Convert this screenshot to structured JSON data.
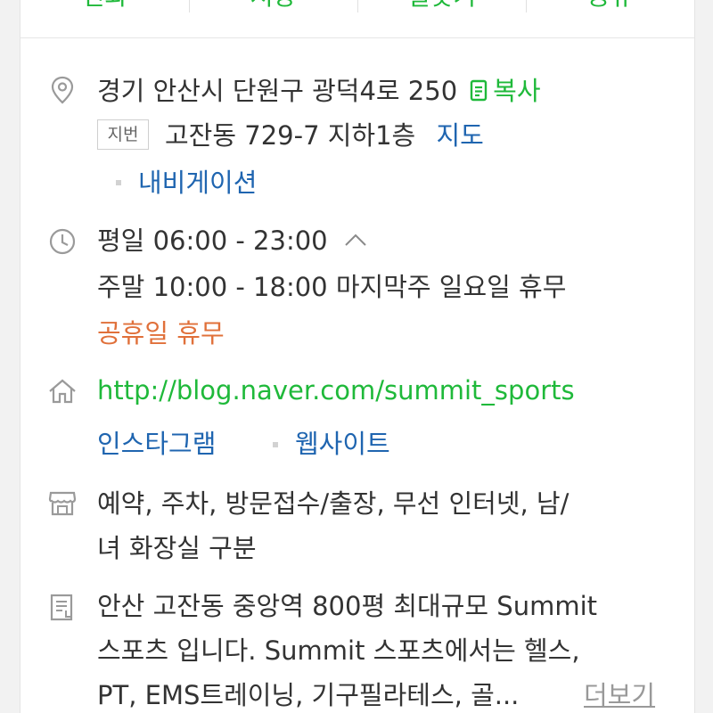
{
  "actions": [
    {
      "label": "전화"
    },
    {
      "label": "저장"
    },
    {
      "label": "길찾기"
    },
    {
      "label": "공유"
    }
  ],
  "address": {
    "road": "경기 안산시 단원구 광덕4로 250",
    "copy_label": "복사",
    "lot_tag": "지번",
    "lot": "고잔동 729-7 지하1층",
    "map_label": "지도",
    "navigation_label": "내비게이션"
  },
  "hours": {
    "weekday": "평일 06:00 - 23:00",
    "weekend": "주말 10:00 - 18:00 마지막주 일요일 휴무",
    "holiday": "공휴일 휴무"
  },
  "website": {
    "url": "http://blog.naver.com/summit_sports",
    "instagram_label": "인스타그램",
    "site_label": "웹사이트"
  },
  "amenities": {
    "line1": "예약, 주차, 방문접수/출장, 무선 인터넷, 남/",
    "line2": "녀 화장실 구분"
  },
  "description": {
    "line1": "안산 고잔동 중앙역 800평 최대규모 Summit",
    "line2": "스포츠 입니다.  Summit 스포츠에서는 헬스,",
    "line3": "PT, EMS트레이닝, 기구필라테스, 골...",
    "more_label": "더보기"
  },
  "colors": {
    "accent_green": "#1fb93a",
    "link_blue": "#1f65b0",
    "holiday_orange": "#e0703a"
  }
}
